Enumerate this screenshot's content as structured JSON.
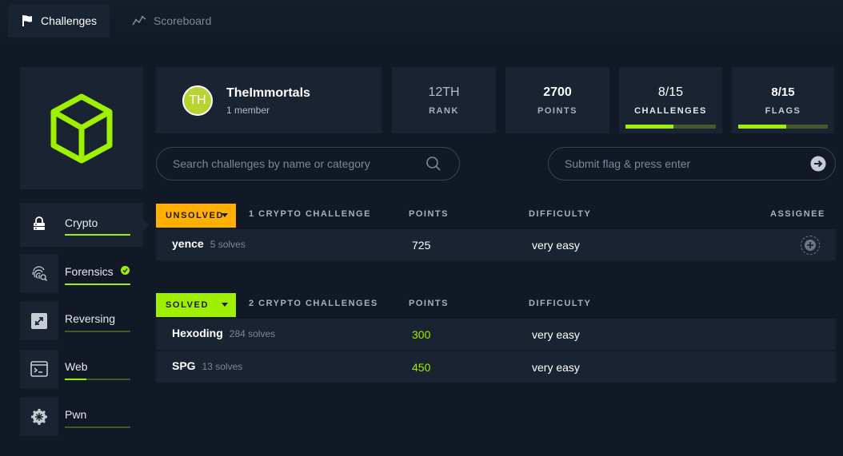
{
  "tabs": {
    "challenges": "Challenges",
    "scoreboard": "Scoreboard"
  },
  "team": {
    "initials": "TH",
    "name": "TheImmortals",
    "members": "1 member"
  },
  "stats": {
    "rank_value": "12TH",
    "rank_label": "RANK",
    "points_value": "2700",
    "points_label": "POINTS",
    "challenges_value": "8/15",
    "challenges_label": "CHALLENGES",
    "challenges_progress": 0.533,
    "flags_value": "8/15",
    "flags_label": "FLAGS",
    "flags_progress": 0.533
  },
  "search": {
    "challenges_placeholder": "Search challenges by name or category",
    "flag_placeholder": "Submit flag & press enter"
  },
  "categories": [
    {
      "label": "Crypto",
      "icon": "server-lock-icon",
      "progress": 1.0,
      "solved": false
    },
    {
      "label": "Forensics",
      "icon": "fingerprint-icon",
      "progress": 1.0,
      "solved": true
    },
    {
      "label": "Reversing",
      "icon": "reversing-icon",
      "progress": 0.0,
      "solved": false
    },
    {
      "label": "Web",
      "icon": "terminal-window-icon",
      "progress": 0.33,
      "solved": false
    },
    {
      "label": "Pwn",
      "icon": "gear-icon",
      "progress": 0.0,
      "solved": false
    }
  ],
  "unsolved": {
    "badge": "UNSOLVED",
    "count_label": "1 CRYPTO CHALLENGE",
    "col_points": "POINTS",
    "col_difficulty": "DIFFICULTY",
    "col_assignee": "ASSIGNEE",
    "rows": [
      {
        "name": "yence",
        "solves": "5 solves",
        "points": "725",
        "difficulty": "very easy"
      }
    ]
  },
  "solved": {
    "badge": "SOLVED",
    "count_label": "2 CRYPTO CHALLENGES",
    "col_points": "POINTS",
    "col_difficulty": "DIFFICULTY",
    "rows": [
      {
        "name": "Hexoding",
        "solves": "284 solves",
        "points": "300",
        "difficulty": "very easy"
      },
      {
        "name": "SPG",
        "solves": "13 solves",
        "points": "450",
        "difficulty": "very easy"
      }
    ]
  },
  "colors": {
    "accent": "#9fef00",
    "unsolved": "#ffaf00",
    "panel": "#1a2332",
    "background": "#111927"
  }
}
